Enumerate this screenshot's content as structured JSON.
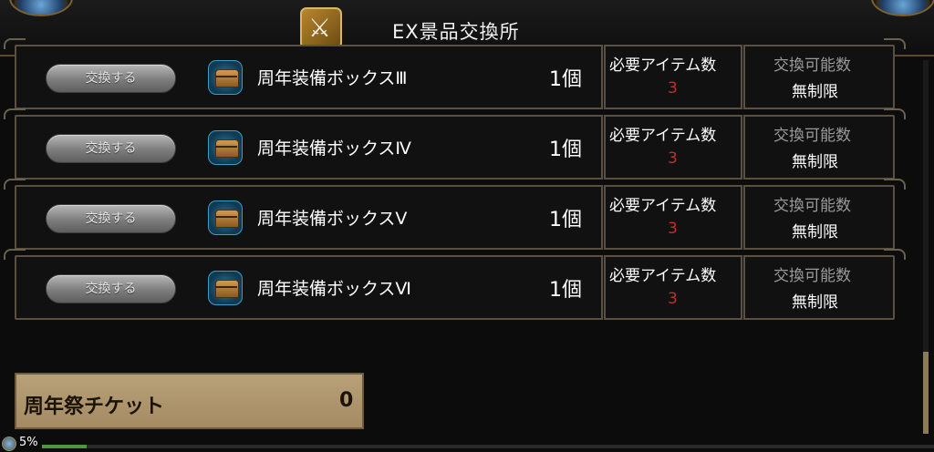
{
  "header": {
    "title": "EX景品交換所",
    "icon": "sword-shop-icon"
  },
  "rows": [
    {
      "button": "交換する",
      "icon": "treasure-chest-icon",
      "name": "周年装備ボックスⅢ",
      "quantity": "1個",
      "required_label": "必要アイテム数",
      "required_value": "3",
      "limit_label": "交換可能数",
      "limit_value": "無制限"
    },
    {
      "button": "交換する",
      "icon": "treasure-chest-icon",
      "name": "周年装備ボックスⅣ",
      "quantity": "1個",
      "required_label": "必要アイテム数",
      "required_value": "3",
      "limit_label": "交換可能数",
      "limit_value": "無制限"
    },
    {
      "button": "交換する",
      "icon": "treasure-chest-icon",
      "name": "周年装備ボックスⅤ",
      "quantity": "1個",
      "required_label": "必要アイテム数",
      "required_value": "3",
      "limit_label": "交換可能数",
      "limit_value": "無制限"
    },
    {
      "button": "交換する",
      "icon": "treasure-chest-icon",
      "name": "周年装備ボックスⅥ",
      "quantity": "1個",
      "required_label": "必要アイテム数",
      "required_value": "3",
      "limit_label": "交換可能数",
      "limit_value": "無制限"
    }
  ],
  "ticket": {
    "label": "周年祭チケット",
    "value": "0"
  },
  "status": {
    "percent_text": "5%",
    "progress": 0.05
  },
  "colors": {
    "required_value": "#c0302a",
    "panel": "#b8a078",
    "border": "#5a5042"
  }
}
